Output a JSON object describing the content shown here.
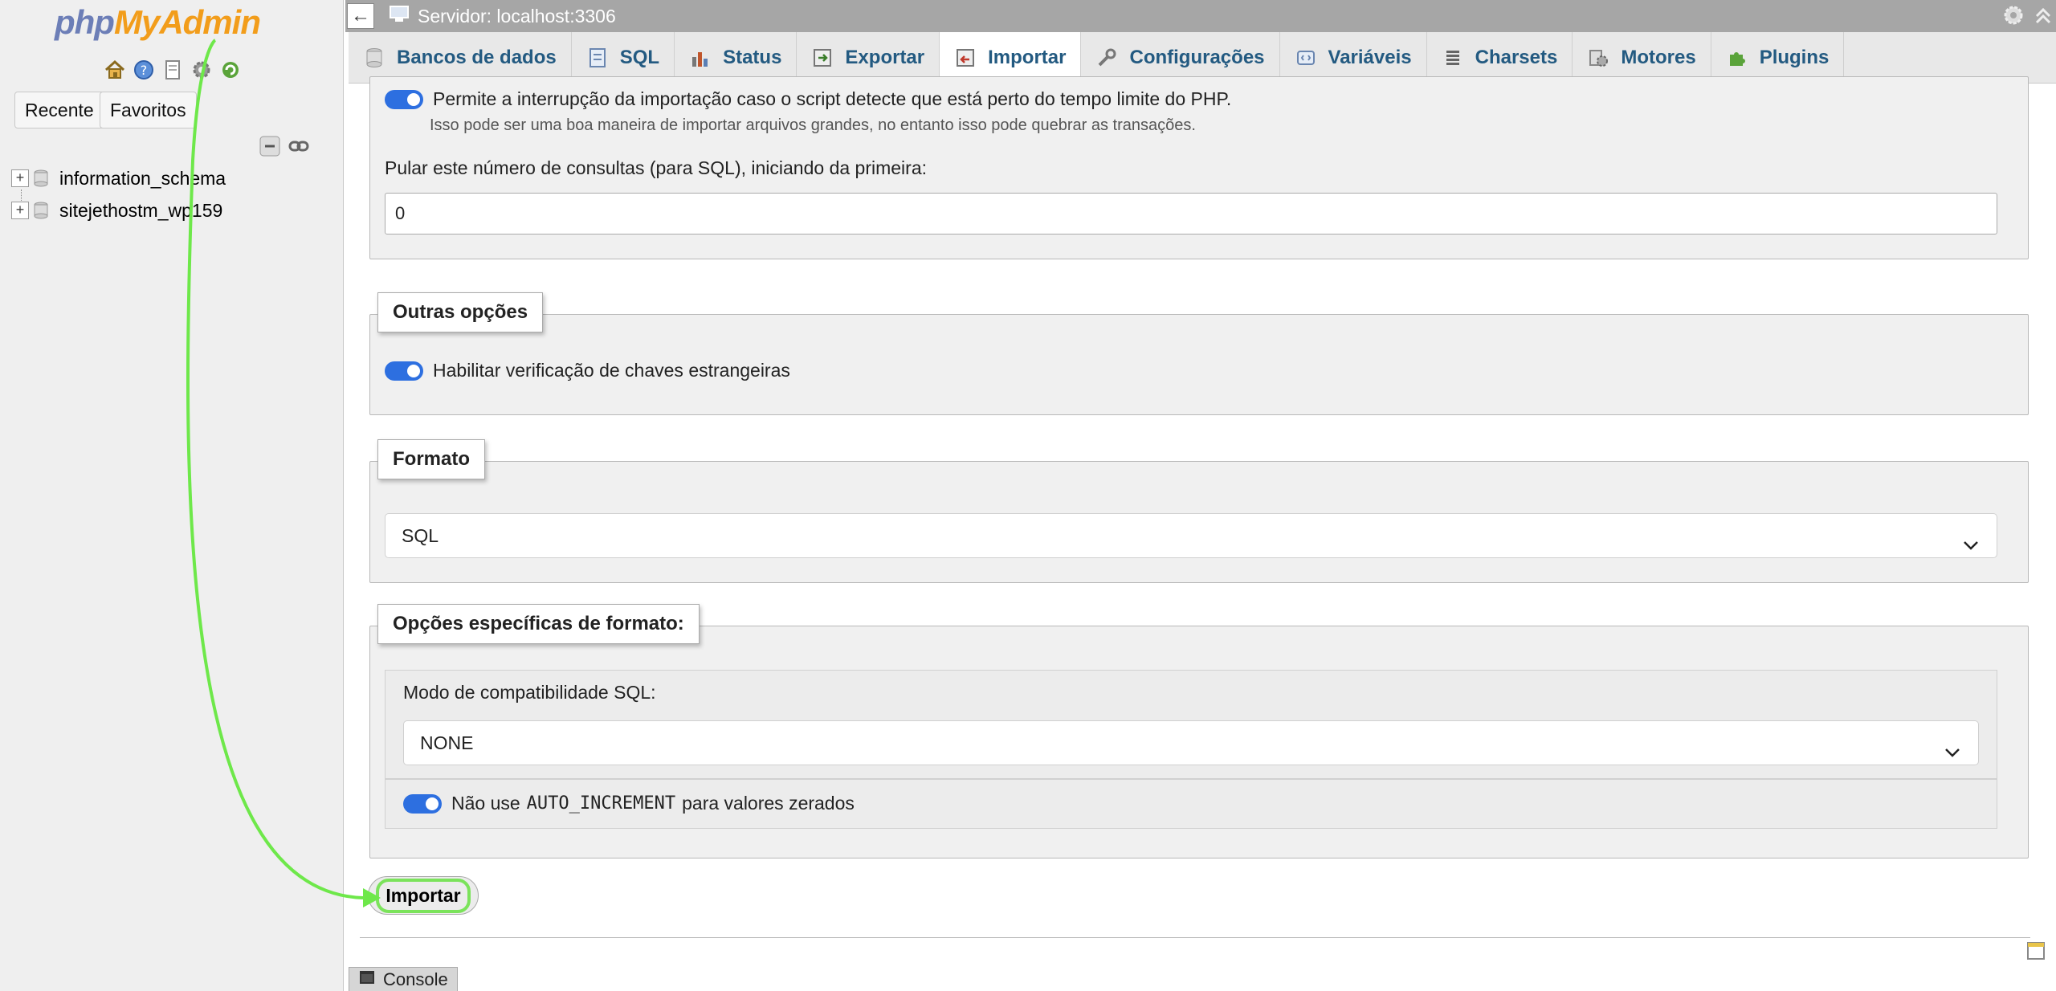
{
  "sidebar": {
    "logo_php": "php",
    "logo_myadmin": "MyAdmin",
    "recent_label": "Recente",
    "favorites_label": "Favoritos",
    "databases": [
      {
        "name": "information_schema"
      },
      {
        "name": "sitejethostm_wp159"
      }
    ]
  },
  "topbar": {
    "back_arrow": "←",
    "server_title": "Servidor: localhost:3306"
  },
  "tabs": [
    {
      "label": "Bancos de dados",
      "icon": "database-icon"
    },
    {
      "label": "SQL",
      "icon": "sql-icon"
    },
    {
      "label": "Status",
      "icon": "status-chart-icon"
    },
    {
      "label": "Exportar",
      "icon": "export-icon"
    },
    {
      "label": "Importar",
      "icon": "import-icon",
      "active": true
    },
    {
      "label": "Configurações",
      "icon": "wrench-icon"
    },
    {
      "label": "Variáveis",
      "icon": "variables-icon"
    },
    {
      "label": "Charsets",
      "icon": "charsets-icon"
    },
    {
      "label": "Motores",
      "icon": "engines-icon"
    },
    {
      "label": "Plugins",
      "icon": "plugin-icon"
    }
  ],
  "partial_import": {
    "allow_interrupt_label": "Permite a interrupção da importação caso o script detecte que está perto do tempo limite do PHP.",
    "allow_interrupt_hint": "Isso pode ser uma boa maneira de importar arquivos grandes, no entanto isso pode quebrar as transações.",
    "skip_label": "Pular este número de consultas (para SQL), iniciando da primeira:",
    "skip_value": "0"
  },
  "other_options": {
    "legend": "Outras opções",
    "fk_checks_label": "Habilitar verificação de chaves estrangeiras"
  },
  "format": {
    "legend": "Formato",
    "selected": "SQL"
  },
  "format_specific": {
    "legend": "Opções específicas de formato:",
    "compat_label": "Modo de compatibilidade SQL:",
    "compat_selected": "NONE",
    "no_auto_value_prefix": "Não use",
    "no_auto_value_code": "AUTO_INCREMENT",
    "no_auto_value_suffix": "para valores zerados"
  },
  "actions": {
    "import_label": "Importar"
  },
  "console": {
    "label": "Console"
  },
  "colors": {
    "accent_tab_text": "#235a81",
    "toggle_on": "#2d6fe0",
    "annotation_arrow": "#6ee84a"
  }
}
